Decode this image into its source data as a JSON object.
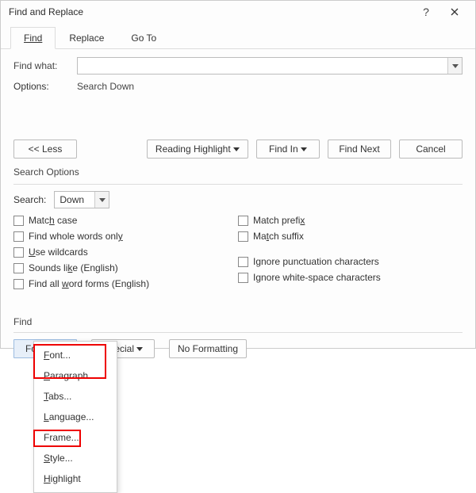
{
  "titlebar": {
    "title": "Find and Replace"
  },
  "tabs": [
    {
      "label": "Find",
      "active": true
    },
    {
      "label": "Replace",
      "active": false
    },
    {
      "label": "Go To",
      "active": false
    }
  ],
  "find_section": {
    "find_what_label": "Find what:",
    "find_what_value": "",
    "options_label": "Options:",
    "options_value": "Search Down"
  },
  "action_buttons": {
    "less": "<< Less",
    "reading_highlight": "Reading Highlight",
    "find_in": "Find In",
    "find_next": "Find Next",
    "cancel": "Cancel"
  },
  "search_options": {
    "title": "Search Options",
    "search_label": "Search:",
    "search_direction": "Down",
    "left_checks": [
      {
        "label_pre": "Matc",
        "label_ul": "h",
        "label_post": " case"
      },
      {
        "label_pre": "Find whole words onl",
        "label_ul": "y",
        "label_post": ""
      },
      {
        "label_pre": "",
        "label_ul": "U",
        "label_post": "se wildcards"
      },
      {
        "label_pre": "Sounds li",
        "label_ul": "k",
        "label_post": "e (English)"
      },
      {
        "label_pre": "Find all ",
        "label_ul": "w",
        "label_post": "ord forms (English)"
      }
    ],
    "right_checks": [
      {
        "label_pre": "Match prefi",
        "label_ul": "x",
        "label_post": ""
      },
      {
        "label_pre": "Ma",
        "label_ul": "t",
        "label_post": "ch suffix"
      },
      {
        "label_pre": "Ignore punctuation characters",
        "label_ul": "",
        "label_post": ""
      },
      {
        "label_pre": "Ignore white-space characters",
        "label_ul": "",
        "label_post": ""
      }
    ]
  },
  "bottom": {
    "group_title": "Find",
    "format": "Format",
    "special": "Special",
    "no_formatting": "No Formatting"
  },
  "format_menu": {
    "items": [
      {
        "ul": "F",
        "rest": "ont..."
      },
      {
        "ul": "P",
        "rest": "aragraph..."
      },
      {
        "ul": "T",
        "rest": "abs..."
      },
      {
        "ul": "L",
        "rest": "anguage..."
      },
      {
        "ul": "",
        "rest": "Frame..."
      },
      {
        "ul": "S",
        "rest": "tyle..."
      },
      {
        "ul": "H",
        "rest": "ighlight"
      }
    ]
  }
}
